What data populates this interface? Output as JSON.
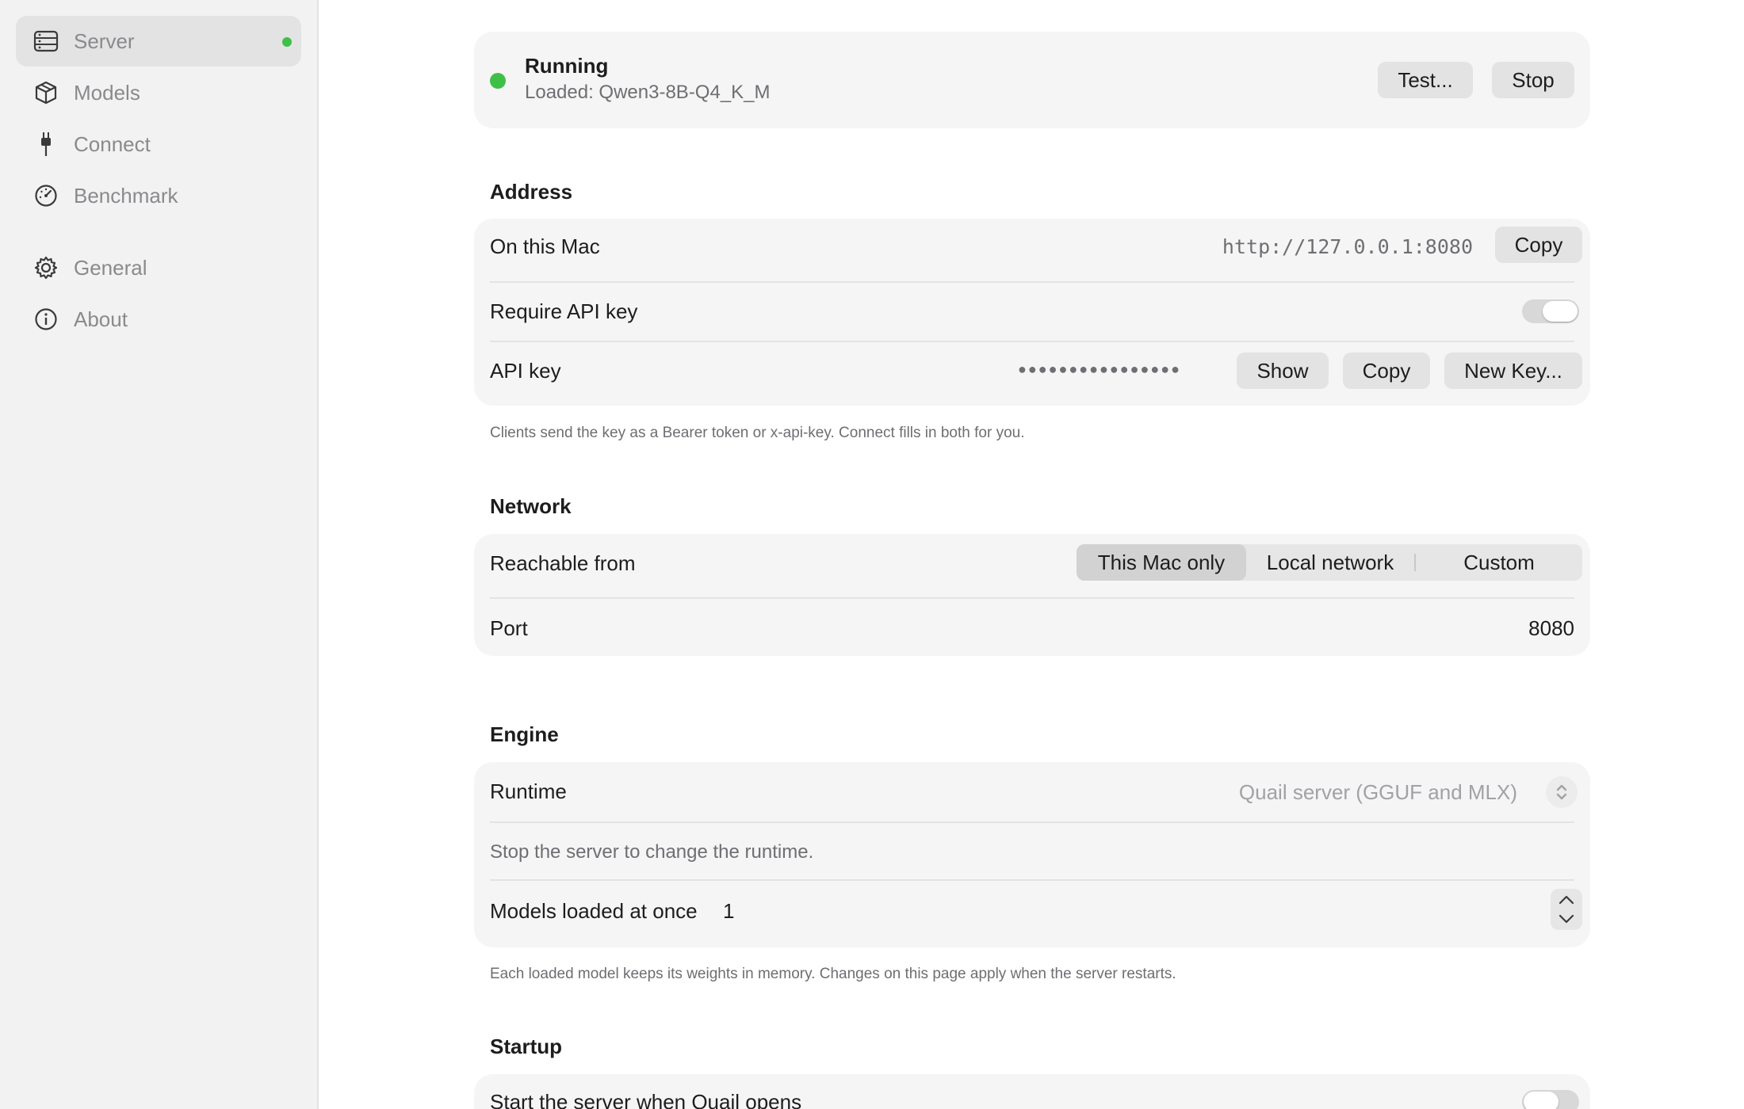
{
  "sidebar": {
    "items": [
      {
        "label": "Server",
        "icon": "server-icon",
        "active": true
      },
      {
        "label": "Models",
        "icon": "cube-icon"
      },
      {
        "label": "Connect",
        "icon": "plug-icon"
      },
      {
        "label": "Benchmark",
        "icon": "gauge-icon"
      },
      {
        "label": "General",
        "icon": "gear-icon"
      },
      {
        "label": "About",
        "icon": "info-icon"
      }
    ]
  },
  "status": {
    "title": "Running",
    "subtitle": "Loaded: Qwen3-8B-Q4_K_M",
    "test_label": "Test...",
    "stop_label": "Stop",
    "color": "#3ec048"
  },
  "address": {
    "title": "Address",
    "on_mac_label": "On this Mac",
    "url": "http://127.0.0.1:8080",
    "copy_label": "Copy",
    "require_key_label": "Require API key",
    "api_key_label": "API key",
    "api_key_masked": "●●●●●●●●●●●●●●●●",
    "show_label": "Show",
    "copy_key_label": "Copy",
    "new_key_label": "New Key...",
    "note": "Clients send the key as a Bearer token or x-api-key. Connect fills in both for you."
  },
  "network": {
    "title": "Network",
    "reachable_label": "Reachable from",
    "options": [
      "This Mac only",
      "Local network",
      "Custom"
    ],
    "selected": "This Mac only",
    "port_label": "Port",
    "port_value": "8080"
  },
  "engine": {
    "title": "Engine",
    "runtime_label": "Runtime",
    "runtime_value": "Quail server (GGUF and MLX)",
    "runtime_note": "Stop the server to change the runtime.",
    "models_loaded_label": "Models loaded at once",
    "models_loaded_value": "1",
    "note": "Each loaded model keeps its weights in memory. Changes on this page apply when the server restarts."
  },
  "startup": {
    "title": "Startup",
    "start_label": "Start the server when Quail opens"
  }
}
